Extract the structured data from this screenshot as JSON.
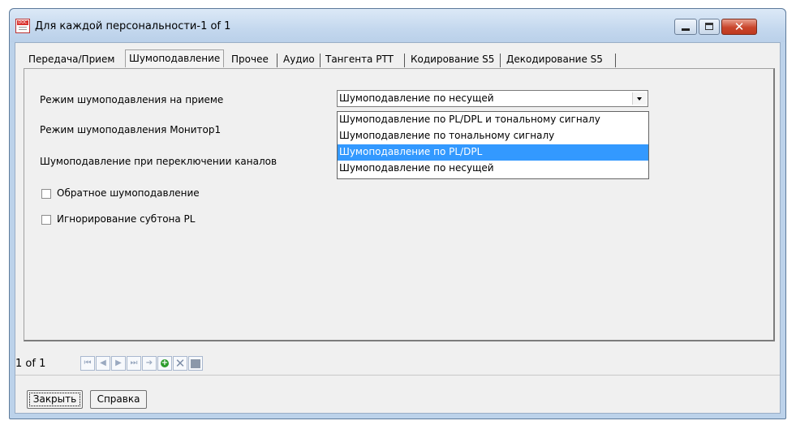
{
  "window": {
    "title": "Для каждой персональности-1 of 1"
  },
  "tabs": [
    {
      "label": "Передача/Прием"
    },
    {
      "label": "Шумоподавление",
      "active": true
    },
    {
      "label": "Прочее"
    },
    {
      "label": "Аудио"
    },
    {
      "label": "Тангента PTT"
    },
    {
      "label": "Кодирование S5"
    },
    {
      "label": "Декодирование S5"
    }
  ],
  "squelch": {
    "rx_mode_label": "Режим шумоподавления на приеме",
    "monitor_mode_label": "Режим шумоподавления Монитор1",
    "channel_switch_label": "Шумоподавление при переключении каналов",
    "reverse_squelch_label": "Обратное шумоподавление",
    "reverse_squelch_checked": false,
    "ignore_pl_label": "Игнорирование субтона PL",
    "ignore_pl_checked": false,
    "rx_mode_value": "Шумоподавление по несущей",
    "options": [
      "Шумоподавление по PL/DPL и тональному сигналу",
      "Шумоподавление по тональному сигналу",
      "Шумоподавление по PL/DPL",
      "Шумоподавление по несущей"
    ],
    "highlighted_option_index": 2
  },
  "navigator": {
    "record_text": "1 of 1",
    "icons": [
      "first-record-icon",
      "prev-record-icon",
      "next-record-icon",
      "last-record-icon",
      "goto-record-icon",
      "add-record-icon",
      "delete-record-icon",
      "save-record-icon"
    ]
  },
  "buttons": {
    "close_label": "Закрыть",
    "help_label": "Справка"
  },
  "colors": {
    "selection": "#3399ff",
    "titlebar": "#c4d8ee",
    "close_button": "#c9452c"
  }
}
